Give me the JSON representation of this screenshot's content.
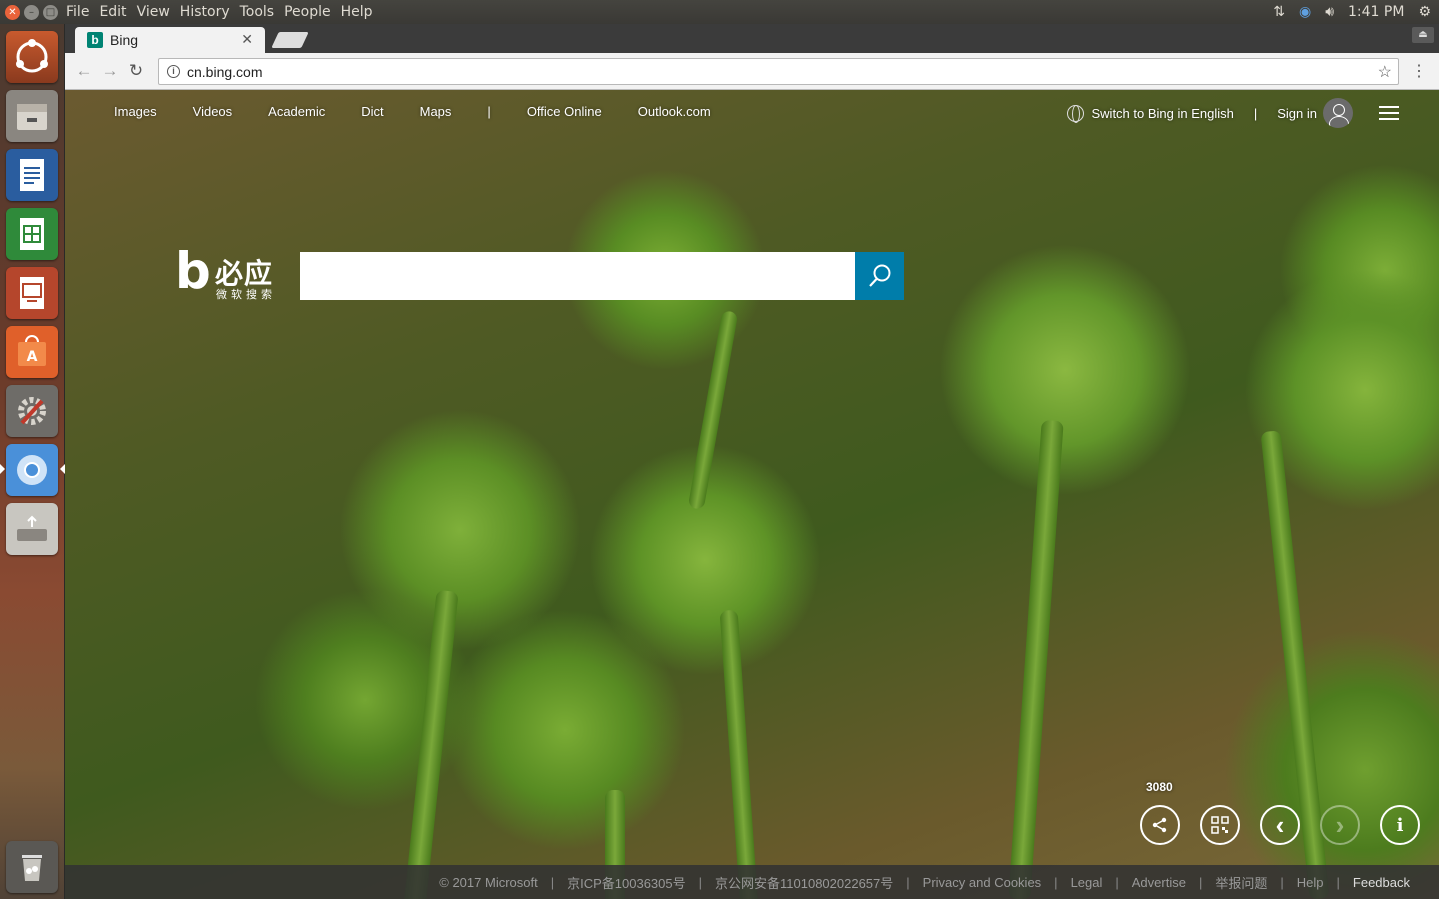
{
  "window": {
    "close_glyph": "✕",
    "min_glyph": "–",
    "max_glyph": "□"
  },
  "menubar": [
    "File",
    "Edit",
    "View",
    "History",
    "Tools",
    "People",
    "Help"
  ],
  "panel": {
    "time": "1:41 PM"
  },
  "tab": {
    "favicon": "b",
    "title": "Bing",
    "close": "✕"
  },
  "toolbar": {
    "back": "←",
    "forward": "→",
    "reload": "↻",
    "url": "cn.bing.com",
    "info": "i",
    "star": "☆",
    "menu": "⋮"
  },
  "bing": {
    "nav": [
      "Images",
      "Videos",
      "Academic",
      "Dict",
      "Maps",
      "|",
      "Office Online",
      "Outlook.com"
    ],
    "switch_lang": "Switch to Bing in English",
    "divider": "|",
    "sign_in": "Sign in",
    "logo_b": "b",
    "logo_cn": "必应",
    "logo_sub": "微软搜索",
    "image_counter": "3080",
    "footer": [
      {
        "label": "© 2017 Microsoft",
        "bright": false
      },
      {
        "label": "京ICP备10036305号",
        "bright": false
      },
      {
        "label": "京公网安备11010802022657号",
        "bright": false
      },
      {
        "label": "Privacy and Cookies",
        "bright": false
      },
      {
        "label": "Legal",
        "bright": false
      },
      {
        "label": "Advertise",
        "bright": false
      },
      {
        "label": "举报问题",
        "bright": false
      },
      {
        "label": "Help",
        "bright": false
      },
      {
        "label": "Feedback",
        "bright": true
      }
    ],
    "footer_sep": "|"
  },
  "controls": {
    "share_icon": "share-icon",
    "qr_icon": "qr-code-icon",
    "prev_glyph": "‹",
    "next_glyph": "›",
    "info_glyph": "i"
  },
  "colors": {
    "search_button": "#007daa",
    "launcher_active": "#4a90d9"
  }
}
